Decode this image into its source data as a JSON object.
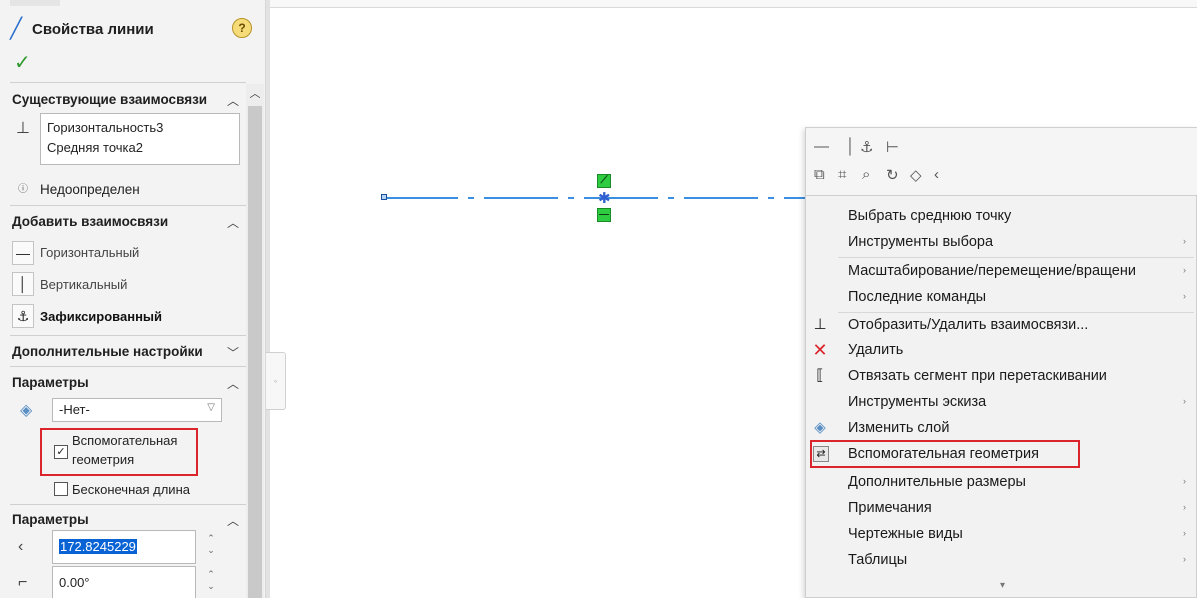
{
  "panel": {
    "title": "Свойства линии",
    "help_icon": "?",
    "existing_relations": {
      "header": "Существующие взаимосвязи",
      "items": [
        "Горизонтальность3",
        "Средняя точка2"
      ],
      "status": "Недоопределен"
    },
    "add_relations": {
      "header": "Добавить взаимосвязи",
      "items": [
        {
          "label": "Горизонтальный",
          "icon": "horizontal-relation-icon"
        },
        {
          "label": "Вертикальный",
          "icon": "vertical-relation-icon"
        },
        {
          "label": "Зафиксированный",
          "icon": "fix-anchor-icon"
        }
      ]
    },
    "advanced_header": "Дополнительные настройки",
    "options": {
      "header": "Параметры",
      "layer_value": "-Нет-",
      "construction_label_1": "Вспомогательная",
      "construction_label_2": "геометрия",
      "construction_checked": true,
      "infinite_length_label": "Бесконечная длина",
      "infinite_checked": false
    },
    "parameters": {
      "header": "Параметры",
      "angle_value": "172.8245229",
      "delta_value": "0.00°"
    }
  },
  "context_menu": {
    "items": [
      {
        "label": "Выбрать среднюю точку",
        "underline": "ы",
        "sub": false,
        "icon": ""
      },
      {
        "label": "Инструменты выбора",
        "sub": true,
        "icon": ""
      },
      {
        "label": "Масштабирование/перемещение/вращени",
        "sub": true,
        "icon": ""
      },
      {
        "label": "Последние команды",
        "sub": true,
        "icon": ""
      },
      {
        "label": "Отобразить/Удалить взаимосвязи...",
        "sub": false,
        "icon": "display-relations-icon"
      },
      {
        "label": "Удалить",
        "sub": false,
        "icon": "delete-icon"
      },
      {
        "label": "Отвязать сегмент при перетаскивании",
        "sub": false,
        "icon": "detach-segment-icon"
      },
      {
        "label": "Инструменты эскиза",
        "sub": true,
        "icon": ""
      },
      {
        "label": "Изменить слой",
        "sub": false,
        "icon": "layer-icon"
      },
      {
        "label": "Вспомогательная геометрия",
        "sub": false,
        "icon": "construction-geometry-icon"
      },
      {
        "label": "Дополнительные размеры",
        "sub": true,
        "icon": ""
      },
      {
        "label": "Примечания",
        "sub": true,
        "icon": ""
      },
      {
        "label": "Чертежные виды",
        "sub": true,
        "icon": ""
      },
      {
        "label": "Таблицы",
        "sub": true,
        "icon": ""
      }
    ]
  },
  "colors": {
    "accent_highlight": "#d9252b",
    "sketch_line": "#3a8fe0",
    "relation_glyph": "#2ecc40"
  }
}
